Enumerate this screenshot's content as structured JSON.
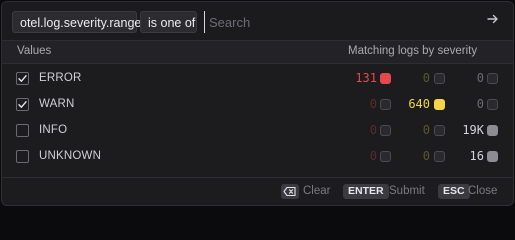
{
  "filter": {
    "key_chip": "otel.log.severity.range",
    "operator_chip": "is one of",
    "search_placeholder": "Search",
    "search_value": ""
  },
  "table": {
    "header_values": "Values",
    "header_matching": "Matching logs by severity",
    "columns": [
      {
        "severity": "error",
        "color": "#e5484d",
        "dim_color": "#5c2a2a"
      },
      {
        "severity": "warn",
        "color": "#f5d547",
        "dim_color": "#5d552b"
      },
      {
        "severity": "other",
        "color": "#8c8c94",
        "dim_color": "#6b6b72"
      }
    ],
    "rows": [
      {
        "label": "ERROR",
        "checked": true,
        "counts": [
          "131",
          "0",
          "0"
        ],
        "active_col": 0
      },
      {
        "label": "WARN",
        "checked": true,
        "counts": [
          "0",
          "640",
          "0"
        ],
        "active_col": 1
      },
      {
        "label": "INFO",
        "checked": false,
        "counts": [
          "0",
          "0",
          "19K"
        ],
        "active_col": 2
      },
      {
        "label": "UNKNOWN",
        "checked": false,
        "counts": [
          "0",
          "0",
          "16"
        ],
        "active_col": 2
      }
    ]
  },
  "footer": {
    "clear_key_icon": "backspace-icon",
    "clear_label": "Clear",
    "submit_key": "ENTER",
    "submit_label": "Submit",
    "close_key": "ESC",
    "close_label": "Close"
  },
  "icons": {
    "submit": "arrow-right-icon",
    "checkbox_checked": "checkmark-icon"
  }
}
